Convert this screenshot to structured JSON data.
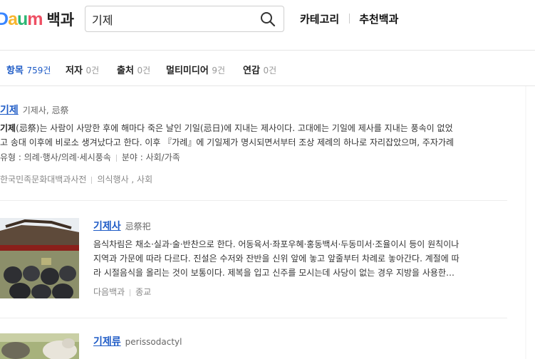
{
  "header": {
    "logo": {
      "brand": "Daum",
      "service": "백과"
    },
    "search": {
      "value": "기제",
      "placeholder": ""
    },
    "nav": [
      {
        "label": "카테고리"
      },
      {
        "label": "추천백과"
      }
    ]
  },
  "tabs": [
    {
      "label": "항목",
      "count": "759건",
      "active": true
    },
    {
      "label": "저자",
      "count": "0건",
      "active": false
    },
    {
      "label": "출처",
      "count": "0건",
      "active": false
    },
    {
      "label": "멀티미디어",
      "count": "9건",
      "active": false
    },
    {
      "label": "연감",
      "count": "0건",
      "active": false
    }
  ],
  "results": [
    {
      "title": "기제",
      "subtitle": "기제사, 忌祭",
      "desc_bold": "기제",
      "desc": "(忌祭)는 사람이 사망한 후에 해마다 죽은 날인 기일(忌日)에 지내는 제사이다. 고대에는 기일에 제사를 지내는 풍속이 없었",
      "desc2": "고 송대 이후에 비로소 생겨났다고 한다. 이후 『가례』에 기일제가 명시되면서부터 조상 제례의 하나로 자리잡았으며, 주자가례",
      "meta": "유형 : 의례·행사/의례·세시풍속",
      "meta2": "분야 : 사회/가족",
      "source": "한국민족문화대백과사전",
      "category": "의식행사 , 사회"
    },
    {
      "title": "기제사",
      "subtitle": "忌祭祀",
      "desc": "음식차림은 채소·실과·술·반찬으로 한다. 어동육서·좌포우혜·홍동백서·두동미서·조율이시 등이 원칙이나",
      "desc2": "지역과 가문에 따라 다르다. 진설은 수저와 잔반을 신위 앞에 놓고 앞줄부터 차례로 놓아간다. 계절에 따",
      "desc3": "라 시절음식을 올리는 것이 보통이다. 제복을 입고 신주를 모시는데 사당이 없는 경우 지방을 사용한…",
      "source": "다음백과",
      "category": "종교"
    },
    {
      "title": "기제류",
      "subtitle": "perissodactyl"
    }
  ]
}
